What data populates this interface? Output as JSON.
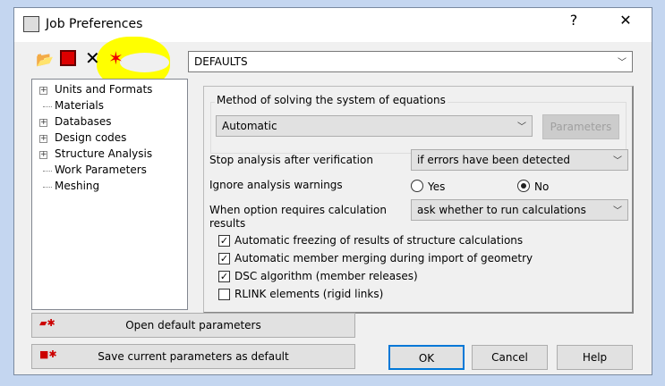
{
  "window": {
    "title": "Job Preferences",
    "help": "?",
    "close": "✕"
  },
  "toolbar": {
    "icons": [
      "open-folder-icon",
      "save-icon",
      "delete-icon",
      "new-icon"
    ]
  },
  "preset": {
    "value": "DEFAULTS"
  },
  "tree": {
    "items": [
      {
        "label": "Units and Formats",
        "expandable": true
      },
      {
        "label": "Materials",
        "expandable": false
      },
      {
        "label": "Databases",
        "expandable": true
      },
      {
        "label": "Design codes",
        "expandable": true
      },
      {
        "label": "Structure Analysis",
        "expandable": true,
        "selected": true
      },
      {
        "label": "Work Parameters",
        "expandable": false
      },
      {
        "label": "Meshing",
        "expandable": false
      }
    ]
  },
  "panel": {
    "method_group_label": "Method of solving the system of equations",
    "method_value": "Automatic",
    "parameters_label": "Parameters",
    "stop_label": "Stop analysis after verification",
    "stop_value": "if errors have been detected",
    "ignore_label": "Ignore analysis warnings",
    "yes_label": "Yes",
    "no_label": "No",
    "ignore_selected": "No",
    "when_label": "When option requires calculation results",
    "when_value": "ask whether to run calculations",
    "checkboxes": [
      {
        "label": "Automatic freezing of results of structure calculations",
        "checked": true
      },
      {
        "label": "Automatic member merging during import of geometry",
        "checked": true
      },
      {
        "label": "DSC algorithm (member releases)",
        "checked": true
      },
      {
        "label": "RLINK elements (rigid links)",
        "checked": false
      }
    ]
  },
  "buttons": {
    "open_default": "Open default parameters",
    "save_default": "Save current parameters as default",
    "ok": "OK",
    "cancel": "Cancel",
    "help": "Help"
  },
  "colors": {
    "highlight": "#ffff00",
    "accent": "#0078d7"
  }
}
